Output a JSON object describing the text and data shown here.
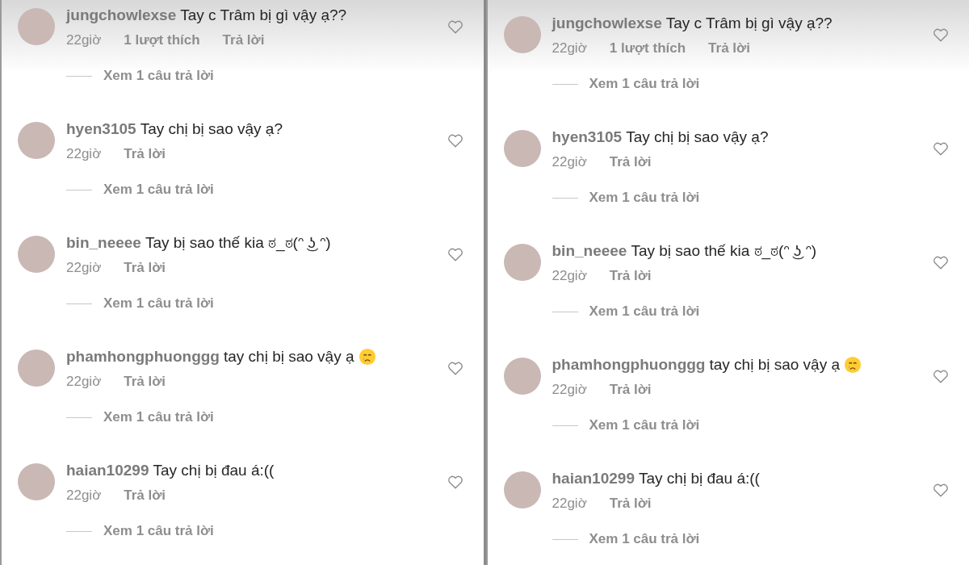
{
  "panels": [
    {
      "comments": [
        {
          "username": "jungchowlexse",
          "text": "Tay c Trâm bị gì vậy ạ??",
          "emoji": false,
          "time": "22giờ",
          "likes": "1 lượt thích",
          "reply": "Trả lời",
          "view_replies": "Xem 1 câu trả lời"
        },
        {
          "username": "hyen3105",
          "text": "Tay chị bị sao vậy ạ?",
          "emoji": false,
          "time": "22giờ",
          "reply": "Trả lời",
          "view_replies": "Xem 1 câu trả lời"
        },
        {
          "username": "bin_neeee",
          "text": "Tay bị sao thế kia ಠ_ಠ(ᵔ ͜ʖ ᵔ)",
          "emoji": false,
          "time": "22giờ",
          "reply": "Trả lời",
          "view_replies": "Xem 1 câu trả lời"
        },
        {
          "username": "phamhongphuonggg",
          "text": "tay chị bị sao vậy ạ",
          "emoji": true,
          "time": "22giờ",
          "reply": "Trả lời",
          "view_replies": "Xem 1 câu trả lời"
        },
        {
          "username": "haian10299",
          "text": "Tay chị bị đau á:((",
          "emoji": false,
          "time": "22giờ",
          "reply": "Trả lời",
          "view_replies": "Xem 1 câu trả lời"
        }
      ]
    },
    {
      "comments": [
        {
          "username": "jungchowlexse",
          "text": "Tay c Trâm bị gì vậy ạ??",
          "emoji": false,
          "time": "22giờ",
          "likes": "1 lượt thích",
          "reply": "Trả lời",
          "view_replies": "Xem 1 câu trả lời"
        },
        {
          "username": "hyen3105",
          "text": "Tay chị bị sao vậy ạ?",
          "emoji": false,
          "time": "22giờ",
          "reply": "Trả lời",
          "view_replies": "Xem 1 câu trả lời"
        },
        {
          "username": "bin_neeee",
          "text": "Tay bị sao thế kia ಠ_ಠ(ᵔ ͜ʖ ᵔ)",
          "emoji": false,
          "time": "22giờ",
          "reply": "Trả lời",
          "view_replies": "Xem 1 câu trả lời"
        },
        {
          "username": "phamhongphuonggg",
          "text": "tay chị bị sao vậy ạ",
          "emoji": true,
          "time": "22giờ",
          "reply": "Trả lời",
          "view_replies": "Xem 1 câu trả lời"
        },
        {
          "username": "haian10299",
          "text": "Tay chị bị đau á:((",
          "emoji": false,
          "time": "22giờ",
          "reply": "Trả lời",
          "view_replies": "Xem 1 câu trả lời"
        }
      ]
    }
  ]
}
